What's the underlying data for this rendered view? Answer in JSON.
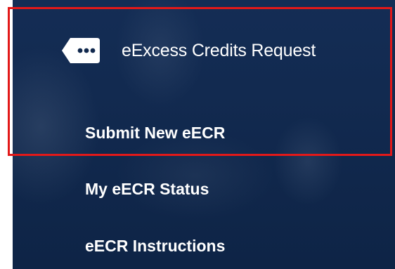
{
  "nav": {
    "header": {
      "label": "eExcess Credits Request",
      "icon": "chat-bubble-ellipsis-icon"
    },
    "items": [
      {
        "label": "Submit New eECR"
      },
      {
        "label": "My eECR Status"
      },
      {
        "label": "eECR Instructions"
      }
    ]
  },
  "colors": {
    "panel_background": "#10284d",
    "text": "#ffffff",
    "highlight_border": "#e21919"
  }
}
